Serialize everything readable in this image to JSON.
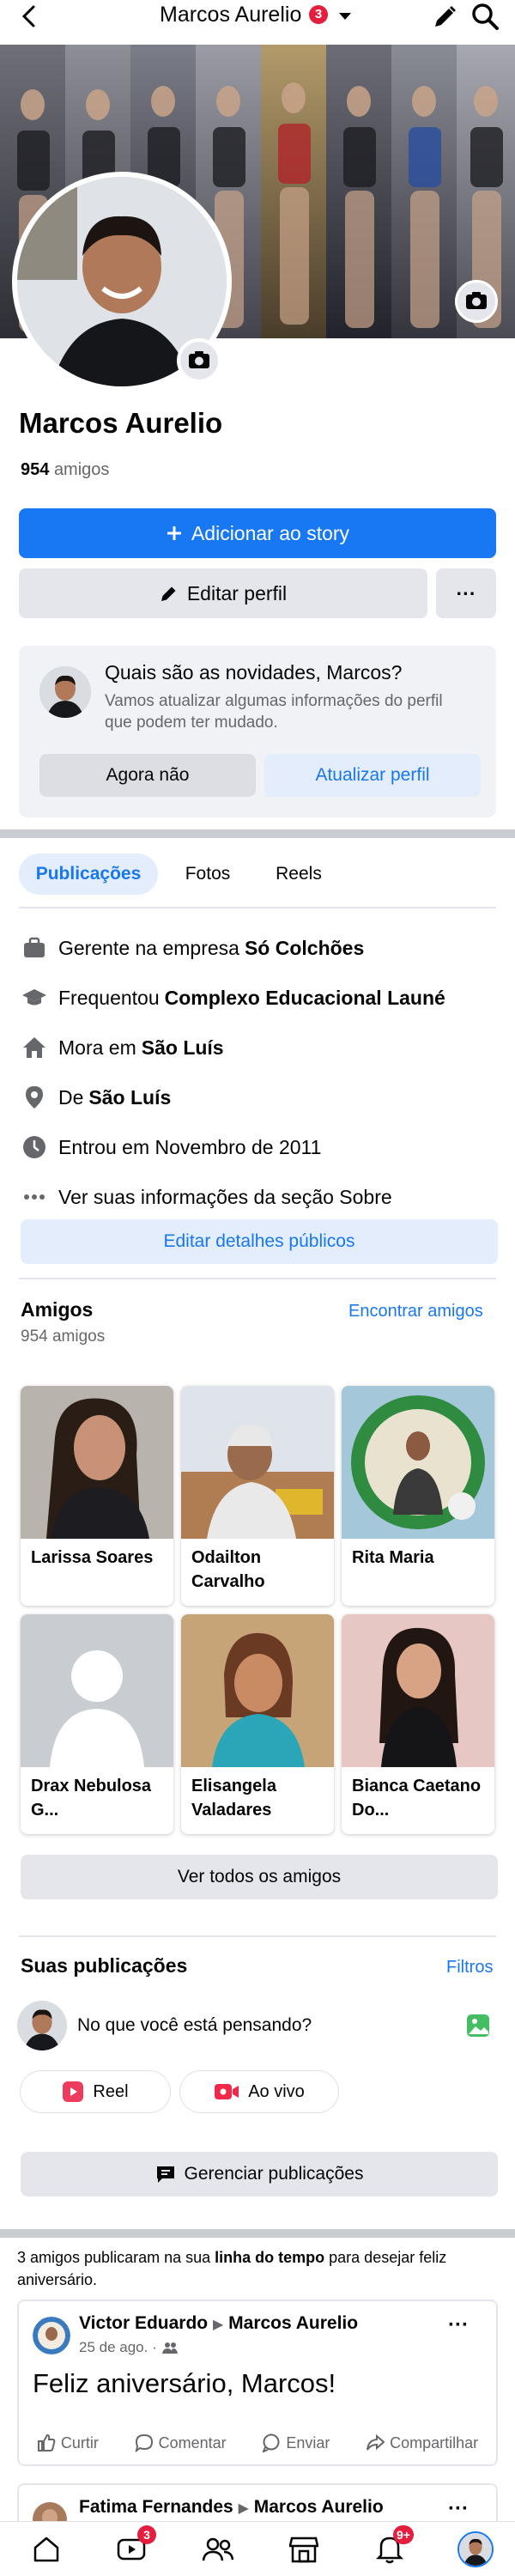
{
  "topbar": {
    "title": "Marcos Aurelio",
    "badge": "3"
  },
  "profile": {
    "name": "Marcos Aurelio",
    "friends_count": "954",
    "friends_word": "amigos",
    "add_story": "Adicionar ao story",
    "edit_profile": "Editar perfil",
    "more": "···"
  },
  "update_card": {
    "question": "Quais são as novidades, Marcos?",
    "description": "Vamos atualizar algumas informações do perfil que podem ter mudado.",
    "later": "Agora não",
    "update": "Atualizar perfil"
  },
  "tabs": [
    "Publicações",
    "Fotos",
    "Reels"
  ],
  "about": [
    {
      "icon": "briefcase-icon",
      "prefix": "Gerente na empresa",
      "bold": "Só Colchões"
    },
    {
      "icon": "graduation-cap-icon",
      "prefix": "Frequentou",
      "bold": "Complexo Educacional Launé"
    },
    {
      "icon": "home-icon",
      "prefix": "Mora em",
      "bold": "São Luís"
    },
    {
      "icon": "location-pin-icon",
      "prefix": "De",
      "bold": "São Luís"
    },
    {
      "icon": "clock-icon",
      "prefix": "Entrou em Novembro de 2011",
      "bold": ""
    },
    {
      "icon": "more-dots-icon",
      "prefix": "Ver suas informações da seção Sobre",
      "bold": ""
    }
  ],
  "edit_public_details": "Editar detalhes públicos",
  "friends_section": {
    "title": "Amigos",
    "count": "954 amigos",
    "find_link": "Encontrar amigos",
    "see_all": "Ver todos os amigos",
    "friends": [
      {
        "name": "Larissa Soares"
      },
      {
        "name": "Odailton Carvalho"
      },
      {
        "name": "Rita Maria"
      },
      {
        "name": "Drax Nebulosa G..."
      },
      {
        "name": "Elisangela Valadares"
      },
      {
        "name": "Bianca Caetano Do..."
      }
    ]
  },
  "posts_section": {
    "title": "Suas publicações",
    "filters": "Filtros",
    "composer_placeholder": "No que você está pensando?",
    "reel": "Reel",
    "live": "Ao vivo",
    "manage": "Gerenciar publicações"
  },
  "birthday_note": {
    "text_a": "3 amigos publicaram na sua",
    "text_bold": "linha do tempo",
    "text_b": "para desejar feliz aniversário."
  },
  "post1": {
    "author": "Victor Eduardo",
    "target": "Marcos Aurelio",
    "date": "25 de ago. ·",
    "text": "Feliz aniversário, Marcos!",
    "actions": [
      "Curtir",
      "Comentar",
      "Enviar",
      "Compartilhar"
    ]
  },
  "post2": {
    "author": "Fatima Fernandes",
    "target": "Marcos Aurelio"
  },
  "bottom_nav": {
    "video_badge": "3",
    "notif_badge": "9+"
  },
  "colors": {
    "accent": "#1877f2",
    "badge": "#e41e3f",
    "light_accent": "#e3edfb",
    "gray_button": "#e4e6eb"
  }
}
